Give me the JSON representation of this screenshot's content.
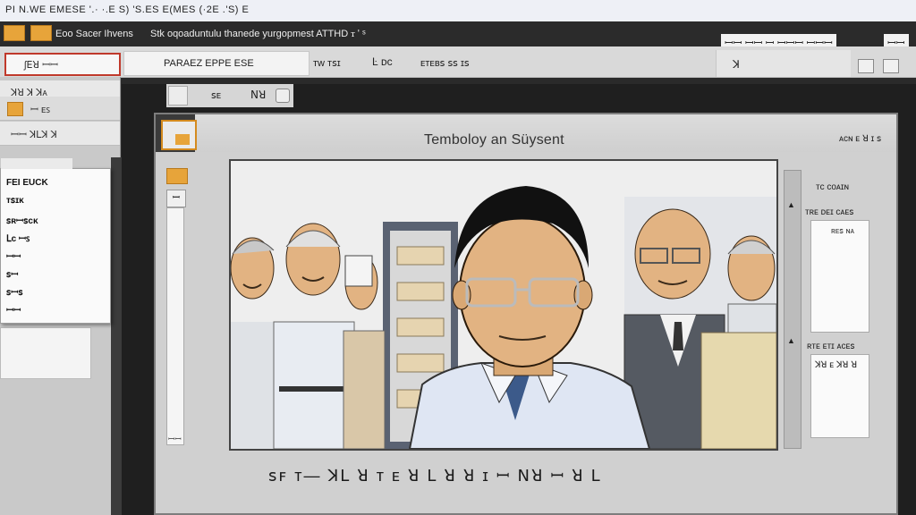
{
  "titlebar": {
    "text": "PI N.WE EMESE '.· ·.E S) 'S.ES E(MES (·2E .'S) E"
  },
  "toolbar": {
    "menu1": "Eoo  Sacer Ihvens",
    "menu2": "Stk oqoaduntulu thanede yurgopmest  ATTHD ꭲ ʹ ˢ",
    "right_label": "ꟷꟷ ꟷꟷ ꟷ  ꟷꟷꟷ  ꟷꟷꟷ",
    "right_label_alt": "ꟷꟷ"
  },
  "ribbon": {
    "selected_label": "ʃꓰꓤ  ꟷꟷ",
    "field_label": "PARAEZ EPPE ESE",
    "item_a": "ᴛᴡ  ᴛꜱɪ",
    "item_b": "Ŀ  ᴅᴄ",
    "item_c": "ᴇᴛᴇʙꜱ ꜱꜱ  ɪꜱ",
    "item_d": "ꓘ"
  },
  "left_panel": {
    "rows": [
      "ꓘꓤ  ꓘ  ꓘᴀ",
      "ꟷ  ᴇꜱ",
      "ꟷꟷ  ꓘꓡꓘ  ꓘ"
    ]
  },
  "flyout": {
    "items": [
      "FEI EUCK",
      "ᴛꜱɪᴋ",
      "ꜱʀꟷꜱᴄᴋ",
      "ꓡᴄ ꟷꜱ",
      "ꟷꟷ",
      "ꜱꟷ",
      "ꜱꟷꜱ",
      "ꟷꟷ"
    ]
  },
  "workspace": {
    "small_label": "ꜱᴇ",
    "small_x": "ꓠꓤ"
  },
  "window": {
    "caption": "Temboloy an Süysent",
    "right_label": "ᴀᴄɴ ᴇ ꓤ ɪ ꜱ",
    "left_icon_label": "ꟷ",
    "scroll_label": "ꟷꟷ",
    "bottom_caption": "ꜱꜰ ᴛ— ꓘꓡ ꓤ ᴛ ᴇ ꓤ ꓡ ꓤ ꓤ ɪ ꟷ ꓠꓤ  ꟷ ꓤ ꓡ",
    "right_panel": {
      "label1": "ᴛᴄ ᴄᴏᴀɪɴ",
      "label2": "ᴛʀᴇ ᴅᴇɪ ᴄᴀᴇꜱ",
      "box1_text": "ʀᴇꜱ ɴᴀ",
      "label3": "ʀᴛᴇ ᴇᴛɪ ᴀᴄᴇꜱ",
      "box2_text": "ꓘꓤ  ᴇ ꓘꓤ ꓤ"
    }
  },
  "colors": {
    "accent_orange": "#e7a43a",
    "selection_red": "#c0392b",
    "shirt_blue": "#dfe6f3",
    "skin": "#e2b382"
  }
}
